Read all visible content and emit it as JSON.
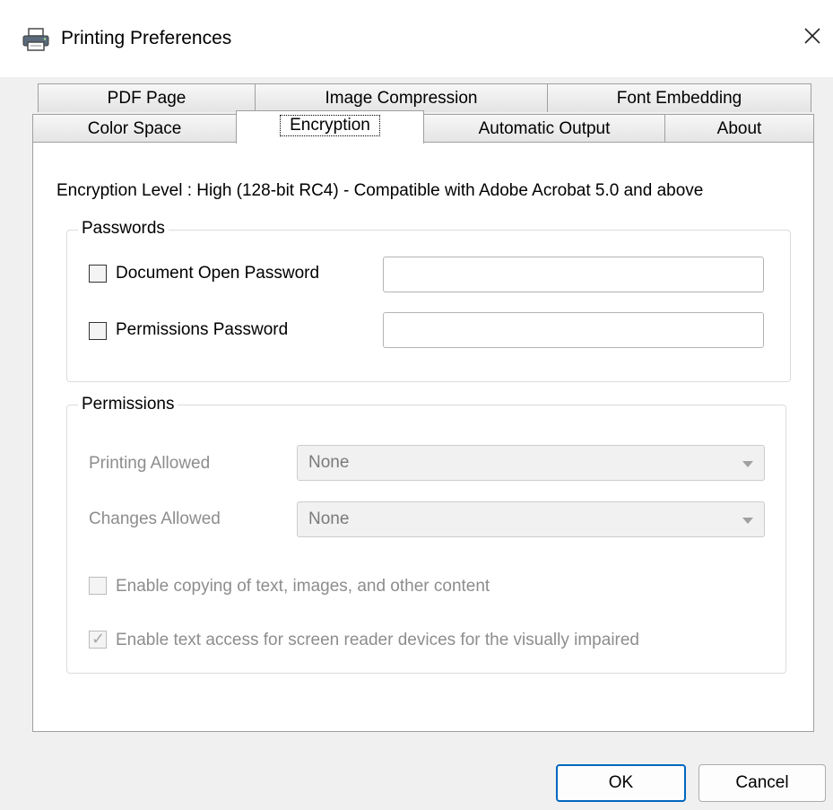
{
  "window": {
    "title": "Printing Preferences",
    "close_glyph": "✕",
    "icon": "printer-icon"
  },
  "tabs": {
    "row1": [
      {
        "label": "PDF Page"
      },
      {
        "label": "Image Compression"
      },
      {
        "label": "Font Embedding"
      }
    ],
    "row2": [
      {
        "label": "Color Space"
      },
      {
        "label": "Encryption",
        "active": true
      },
      {
        "label": "Automatic Output"
      },
      {
        "label": "About"
      }
    ]
  },
  "encryption": {
    "level_text": "Encryption Level : High (128-bit RC4) - Compatible with Adobe Acrobat 5.0 and above"
  },
  "passwords": {
    "group_label": "Passwords",
    "document_open": {
      "label": "Document Open Password",
      "checked": false,
      "value": ""
    },
    "permissions": {
      "label": "Permissions Password",
      "checked": false,
      "value": ""
    }
  },
  "permissions": {
    "group_label": "Permissions",
    "printing": {
      "label": "Printing Allowed",
      "value": "None"
    },
    "changes": {
      "label": "Changes Allowed",
      "value": "None"
    },
    "copying": {
      "label": "Enable copying of text, images, and other content",
      "checked": false
    },
    "screen_reader": {
      "label": "Enable text access for screen reader devices for the visually impaired",
      "checked": true,
      "check_glyph": "✓"
    }
  },
  "buttons": {
    "ok": "OK",
    "cancel": "Cancel"
  },
  "colors": {
    "default_button_border": "#0067c0",
    "disabled_text": "#8d8d8d"
  }
}
